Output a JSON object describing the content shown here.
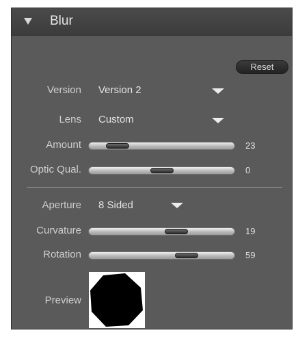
{
  "panel": {
    "title": "Blur",
    "reset_label": "Reset",
    "icons": {
      "collapse": "disclosure-triangle-down",
      "dropdown": "dropdown-triangle"
    }
  },
  "fields": {
    "version": {
      "label": "Version",
      "value": "Version 2"
    },
    "lens": {
      "label": "Lens",
      "value": "Custom"
    },
    "amount": {
      "label": "Amount",
      "value": "23"
    },
    "optic_quality": {
      "label": "Optic Qual.",
      "value": "0"
    },
    "aperture": {
      "label": "Aperture",
      "value": "8 Sided"
    },
    "curvature": {
      "label": "Curvature",
      "value": "19"
    },
    "rotation": {
      "label": "Rotation",
      "value": "59"
    },
    "preview": {
      "label": "Preview",
      "shape": "octagon"
    }
  },
  "sliders": {
    "amount": 0.2,
    "optic_quality": 0.5,
    "curvature": 0.6,
    "rotation": 0.67
  },
  "colors": {
    "panel_bg": "#5a5a5a",
    "header_bg": "#404040",
    "label_text": "#cfcfcf",
    "value_text": "#e4e4e4"
  }
}
